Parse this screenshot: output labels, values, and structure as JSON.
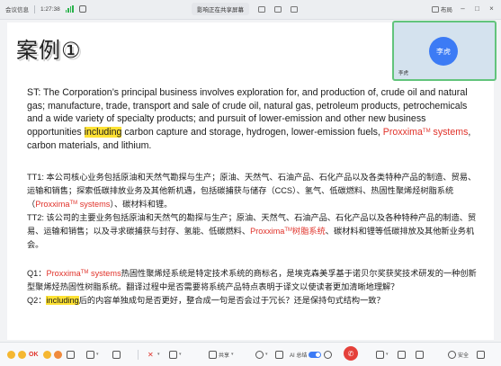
{
  "topbar": {
    "meeting_info": "会议信息",
    "time": "1:27:38",
    "sharing_status": "影响正在共享屏幕",
    "layout_label": "布局"
  },
  "slide": {
    "title": "案例①",
    "en_prefix": "ST: The Corporation’s principal business involves exploration for, and production of, crude oil and natural gas; manufacture, trade, transport and sale of crude oil, natural gas, petroleum products, petrochemicals and a wide variety of specialty products; and pursuit of lower-emission and other new business opportunities ",
    "en_highlight": "including",
    "en_mid": " carbon capture and storage, hydrogen, lower-emission fuels, ",
    "en_proxxima": "Proxxima",
    "en_tm": "TM",
    "en_systems": " systems",
    "en_suffix": ", carbon materials, and lithium.",
    "tt1_prefix": "TT1: 本公司核心业务包括原油和天然气勘探与生产；原油、天然气、石油产品、石化产品以及各类特种产品的制造、贸易、运输和销售；探索低碳排放业务及其他新机遇，包括碳捕获与储存（CCS）、氢气、低碳燃料、热固性聚烯烃树脂系统（",
    "tt1_proxxima": "Proxxima",
    "tt1_tm": "TM",
    "tt1_systems": " systems",
    "tt1_suffix": "）、碳材料和锂。",
    "tt2_prefix": "TT2: 该公司的主要业务包括原油和天然气的勘探与生产；原油、天然气、石油产品、石化产品以及各种特种产品的制造、贸易、运输和销售；以及寻求碳捕获与封存、氢能、低碳燃料、",
    "tt2_proxxima": "Proxxima",
    "tt2_tm": "TM",
    "tt2_resin": "树脂系统",
    "tt2_suffix": "、碳材料和锂等低碳排放及其他新业务机会。",
    "q1_prefix": "Q1：",
    "q1_proxxima": "Proxxima",
    "q1_tm": "TM",
    "q1_systems": " systems",
    "q1_suffix": "热固性聚烯烃系统是特定技术系统的商标名，是埃克森美孚基于诺贝尔奖获奖技术研发的一种创新型聚烯烃热固性树脂系统。翻译过程中是否需要将系统产品特点表明于译文以使读者更加清晰地理解？",
    "q2_prefix": "Q2：",
    "q2_highlight": "including",
    "q2_suffix": "后的内容单独成句是否更好，整合成一句是否会过于冗长？还是保持句式结构一致？"
  },
  "video": {
    "avatar_text": "李虎",
    "name": "李虎"
  },
  "bottombar": {
    "ok_label": "OK",
    "share_label": "共享",
    "ai_label": "AI 总结",
    "security_label": "安全"
  },
  "colors": {
    "highlight": "#ffe234",
    "brand_red": "#e0322a",
    "avatar_blue": "#3c7bf5",
    "active_speaker_green": "#62c47c"
  }
}
